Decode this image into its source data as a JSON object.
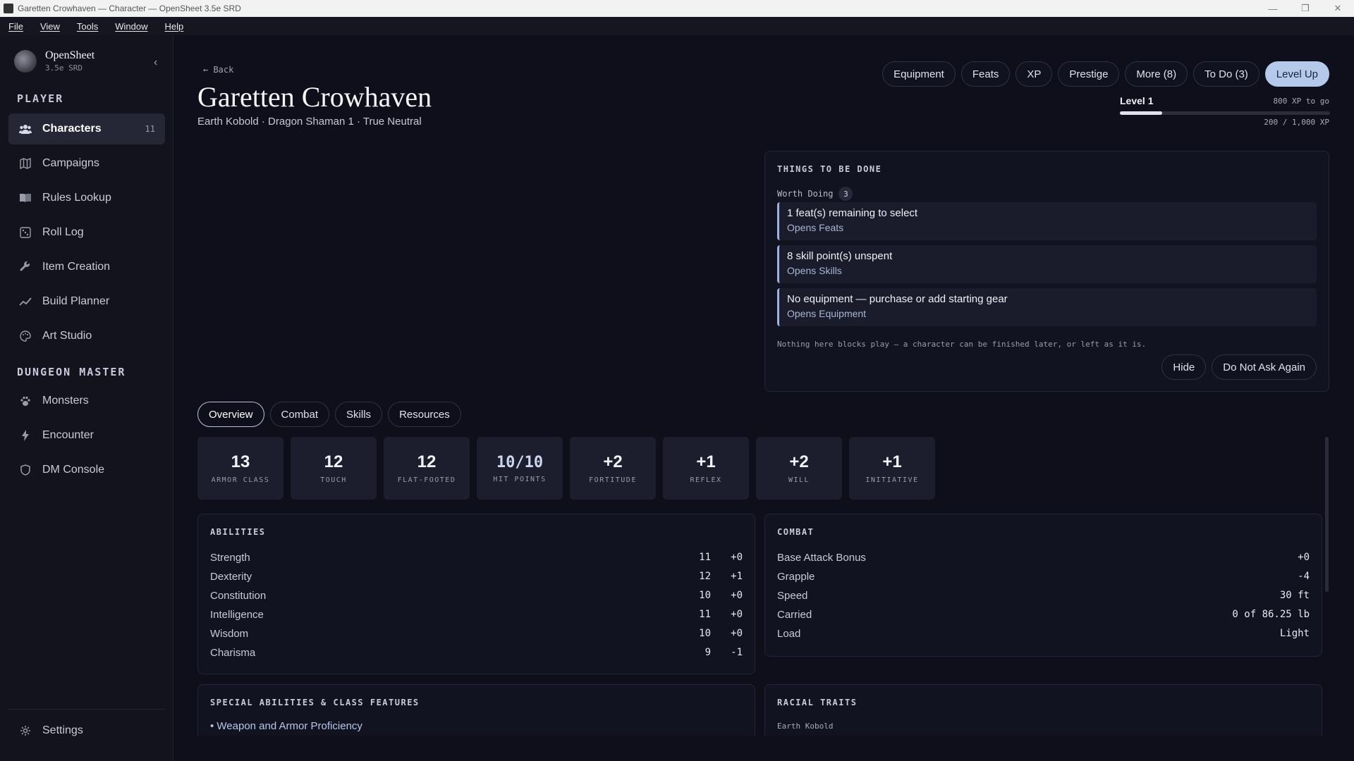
{
  "window": {
    "title": "Garetten Crowhaven — Character — OpenSheet 3.5e SRD"
  },
  "menu": [
    "File",
    "View",
    "Tools",
    "Window",
    "Help"
  ],
  "brand": {
    "name": "OpenSheet",
    "subtitle": "3.5e SRD"
  },
  "sidebar": {
    "player_heading": "PLAYER",
    "player_items": [
      {
        "label": "Characters",
        "count": "11",
        "icon": "users-icon",
        "active": true
      },
      {
        "label": "Campaigns",
        "icon": "map-icon"
      },
      {
        "label": "Rules Lookup",
        "icon": "book-icon"
      },
      {
        "label": "Roll Log",
        "icon": "dice-icon"
      },
      {
        "label": "Item Creation",
        "icon": "wrench-icon"
      },
      {
        "label": "Build Planner",
        "icon": "trend-icon"
      },
      {
        "label": "Art Studio",
        "icon": "palette-icon"
      }
    ],
    "dm_heading": "DUNGEON MASTER",
    "dm_items": [
      {
        "label": "Monsters",
        "icon": "paw-icon"
      },
      {
        "label": "Encounter",
        "icon": "bolt-icon"
      },
      {
        "label": "DM Console",
        "icon": "shield-icon"
      }
    ],
    "settings_label": "Settings"
  },
  "header": {
    "back_label": "Back",
    "name": "Garetten Crowhaven",
    "subtitle": "Earth Kobold · Dragon Shaman 1 · True Neutral",
    "buttons": [
      "Equipment",
      "Feats",
      "XP",
      "Prestige",
      "More (8)",
      "To Do (3)"
    ],
    "level_up_label": "Level Up"
  },
  "xp": {
    "level_label": "Level 1",
    "to_go": "800 XP to go",
    "count": "200 / 1,000 XP",
    "progress": 0.2
  },
  "todo": {
    "title": "THINGS TO BE DONE",
    "group_label": "Worth Doing",
    "group_count": "3",
    "items": [
      {
        "title": "1 feat(s) remaining to select",
        "action": "Opens Feats"
      },
      {
        "title": "8 skill point(s) unspent",
        "action": "Opens Skills"
      },
      {
        "title": "No equipment — purchase or add starting gear",
        "action": "Opens Equipment"
      }
    ],
    "note": "Nothing here blocks play — a character can be finished later, or left as it is.",
    "hide_label": "Hide",
    "dont_ask_label": "Do Not Ask Again"
  },
  "tabs": [
    "Overview",
    "Combat",
    "Skills",
    "Resources"
  ],
  "stats": [
    {
      "value": "13",
      "label": "ARMOR CLASS"
    },
    {
      "value": "12",
      "label": "TOUCH"
    },
    {
      "value": "12",
      "label": "FLAT-FOOTED"
    },
    {
      "value": "10/10",
      "label": "HIT POINTS"
    },
    {
      "value": "+2",
      "label": "FORTITUDE"
    },
    {
      "value": "+1",
      "label": "REFLEX"
    },
    {
      "value": "+2",
      "label": "WILL"
    },
    {
      "value": "+1",
      "label": "INITIATIVE"
    }
  ],
  "abilities": {
    "title": "ABILITIES",
    "rows": [
      {
        "name": "Strength",
        "score": "11",
        "mod": "+0"
      },
      {
        "name": "Dexterity",
        "score": "12",
        "mod": "+1"
      },
      {
        "name": "Constitution",
        "score": "10",
        "mod": "+0"
      },
      {
        "name": "Intelligence",
        "score": "11",
        "mod": "+0"
      },
      {
        "name": "Wisdom",
        "score": "10",
        "mod": "+0"
      },
      {
        "name": "Charisma",
        "score": "9",
        "mod": "-1"
      }
    ]
  },
  "combat": {
    "title": "COMBAT",
    "rows": [
      {
        "name": "Base Attack Bonus",
        "value": "+0"
      },
      {
        "name": "Grapple",
        "value": "-4"
      },
      {
        "name": "Speed",
        "value": "30 ft"
      },
      {
        "name": "Carried",
        "value": "0 of 86.25 lb"
      },
      {
        "name": "Load",
        "value": "Light"
      }
    ]
  },
  "special": {
    "title": "SPECIAL ABILITIES & CLASS FEATURES",
    "first_item": "• Weapon and Armor Proficiency"
  },
  "racial": {
    "title": "RACIAL TRAITS",
    "subtitle": "Earth Kobold"
  },
  "colors": {
    "accent": "#b5c9ea",
    "background": "#0e0f1a",
    "sidebar": "#12131d"
  }
}
